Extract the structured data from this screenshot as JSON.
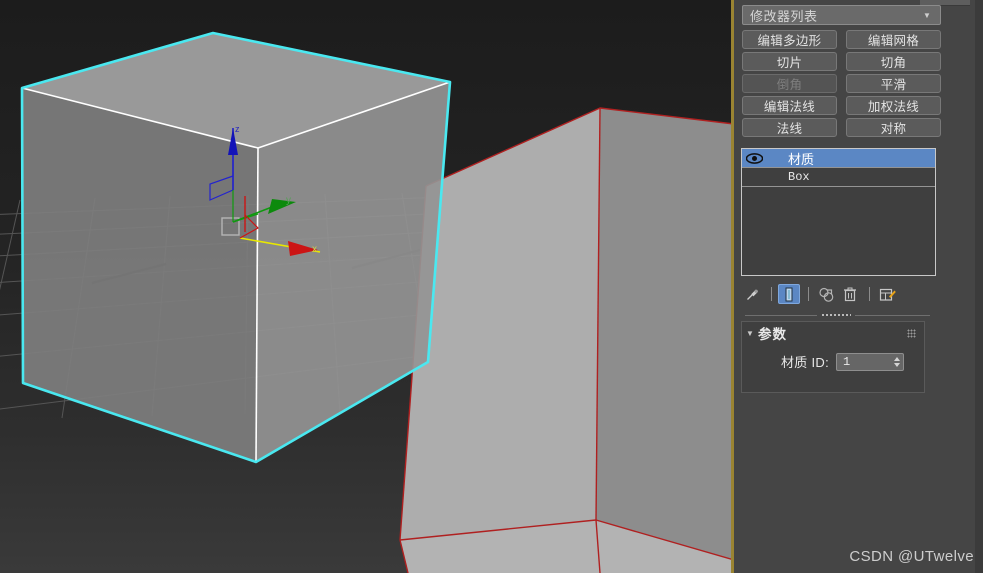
{
  "app": {
    "name": "3ds Max Command Panel"
  },
  "viewport": {
    "name": "perspective-viewport",
    "background_top": "#1c1c1c",
    "background_bottom": "#3a3a3a",
    "active_border_color": "#9a8432",
    "gizmo": {
      "type": "move-gizmo",
      "axes": [
        {
          "name": "z-axis",
          "label": "z",
          "color": "#1414c8"
        },
        {
          "name": "y-axis",
          "label": "y",
          "color": "#0f8c0f"
        },
        {
          "name": "x-axis",
          "label": "x",
          "color": "#cc1414",
          "highlight_color": "#e8e800",
          "state": "highlighted"
        }
      ]
    },
    "objects": [
      {
        "name": "selected-box",
        "label": "Box",
        "selection_outline_color": "#4ae8f0",
        "edge_color": "#ffffff",
        "face_color": "#858585",
        "state": "selected"
      },
      {
        "name": "material-id-box",
        "label": "Box",
        "outline_color": "#b02020",
        "face_color": "#adadad",
        "state": "material-id-highlight"
      }
    ],
    "grid": {
      "name": "home-grid",
      "color": "#5a5a5a",
      "axis_line_color": "#000000"
    }
  },
  "command_panel": {
    "modifier_dropdown": {
      "label": "修改器列表",
      "icon": "chevron-down-icon"
    },
    "modifier_buttons": [
      {
        "label": "编辑多边形",
        "enabled": true
      },
      {
        "label": "编辑网格",
        "enabled": true
      },
      {
        "label": "切片",
        "enabled": true
      },
      {
        "label": "切角",
        "enabled": true
      },
      {
        "label": "倒角",
        "enabled": false
      },
      {
        "label": "平滑",
        "enabled": true
      },
      {
        "label": "编辑法线",
        "enabled": true
      },
      {
        "label": "加权法线",
        "enabled": true
      },
      {
        "label": "法线",
        "enabled": true
      },
      {
        "label": "对称",
        "enabled": true
      }
    ],
    "modifier_stack": {
      "selected_color": "#5b87c4",
      "items": [
        {
          "label": "材质",
          "selected": true,
          "eye": true,
          "mono": false
        },
        {
          "label": "Box",
          "selected": false,
          "eye": false,
          "mono": true
        }
      ]
    },
    "stack_tools": [
      {
        "name": "pin-stack-icon",
        "active": false
      },
      {
        "name": "show-end-result-icon",
        "active": true
      },
      {
        "name": "make-unique-icon",
        "active": false
      },
      {
        "name": "remove-modifier-icon",
        "active": false
      },
      {
        "name": "configure-modifier-sets-icon",
        "active": false
      }
    ],
    "parameters_rollout": {
      "title": "参数",
      "expanded": true,
      "material_id": {
        "label": "材质 ID:",
        "value": "1"
      }
    }
  },
  "watermark": {
    "text": "CSDN @UTwelve"
  }
}
